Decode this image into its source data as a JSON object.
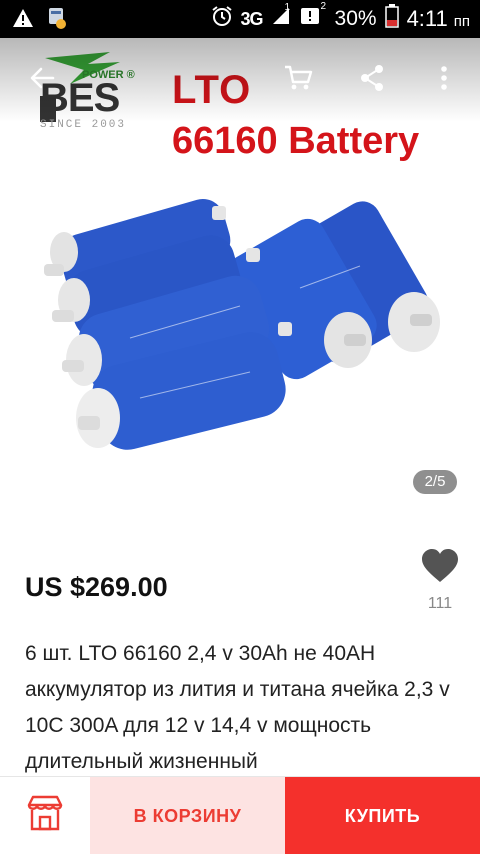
{
  "status_bar": {
    "network": "3G",
    "sim": "1",
    "sim2": "2",
    "battery": "30%",
    "time": "4:11",
    "ampm": "пп"
  },
  "hero": {
    "title_line1": "LTO",
    "title_line2": "66160 Battery",
    "logo_word": "BES",
    "logo_power": "POWER ®",
    "logo_since": "SINCE 2003",
    "image_counter": "2/5"
  },
  "product": {
    "price": "US $269.00",
    "wishlist_count": "111",
    "title": "6 шт. LTO 66160 2,4 v 30Ah не 40AH аккумулятор из лития и титана ячейка 2,3 v 10C 300A для 12 v 14,4 v мощность длительный жизненный"
  },
  "bottom_bar": {
    "add_to_cart_label": "В КОРЗИНУ",
    "buy_label": "КУПИТЬ"
  },
  "colors": {
    "accent": "#f4302c",
    "cart_bg": "#fde3e2",
    "battery_blue": "#2a55c7",
    "title_red": "#d4141a"
  },
  "icons": [
    "warning-icon",
    "app-notification-icon",
    "alarm-icon",
    "signal-icon",
    "sim-icon",
    "battery-icon",
    "back-arrow-icon",
    "cart-icon",
    "share-icon",
    "more-icon",
    "heart-icon",
    "store-icon"
  ]
}
